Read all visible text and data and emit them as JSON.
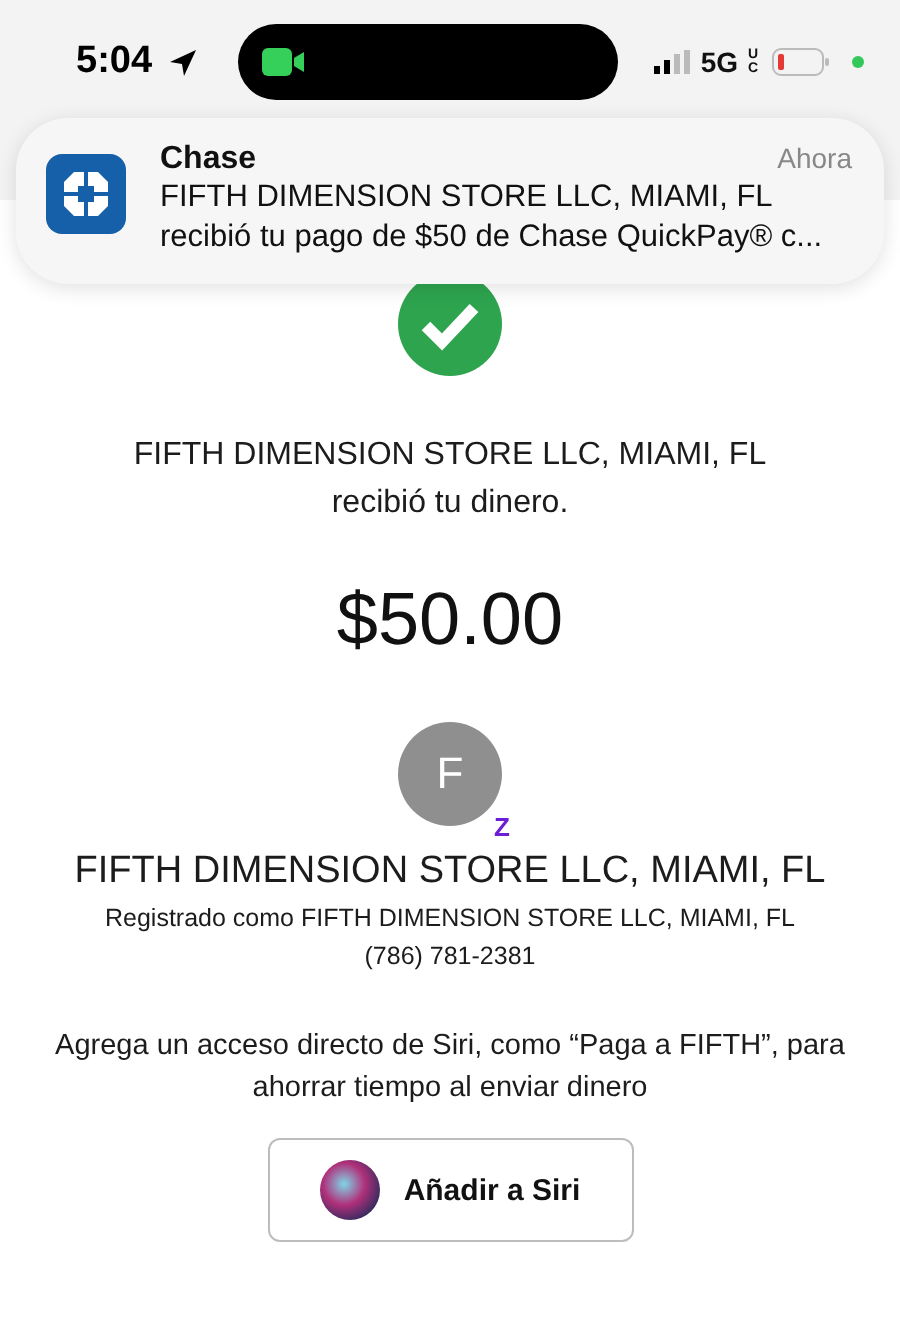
{
  "status_bar": {
    "time": "5:04",
    "network": "5G",
    "network_sub": "UC"
  },
  "notification": {
    "app": "Chase",
    "time": "Ahora",
    "body": "FIFTH DIMENSION STORE LLC, MIAMI, FL recibió tu pago de $50 de Chase QuickPay® c..."
  },
  "confirmation": {
    "message_line_1": "FIFTH DIMENSION STORE LLC, MIAMI, FL",
    "message_line_2": "recibió tu dinero.",
    "amount": "$50.00"
  },
  "recipient": {
    "initial": "F",
    "badge": "Z",
    "name": "FIFTH DIMENSION STORE LLC, MIAMI, FL",
    "registered": "Registrado como FIFTH DIMENSION STORE LLC, MIAMI, FL",
    "phone": "(786) 781-2381"
  },
  "siri": {
    "hint": "Agrega un acceso directo de Siri, como “Paga a FIFTH”, para ahorrar tiempo al enviar dinero",
    "button": "Añadir a Siri"
  }
}
